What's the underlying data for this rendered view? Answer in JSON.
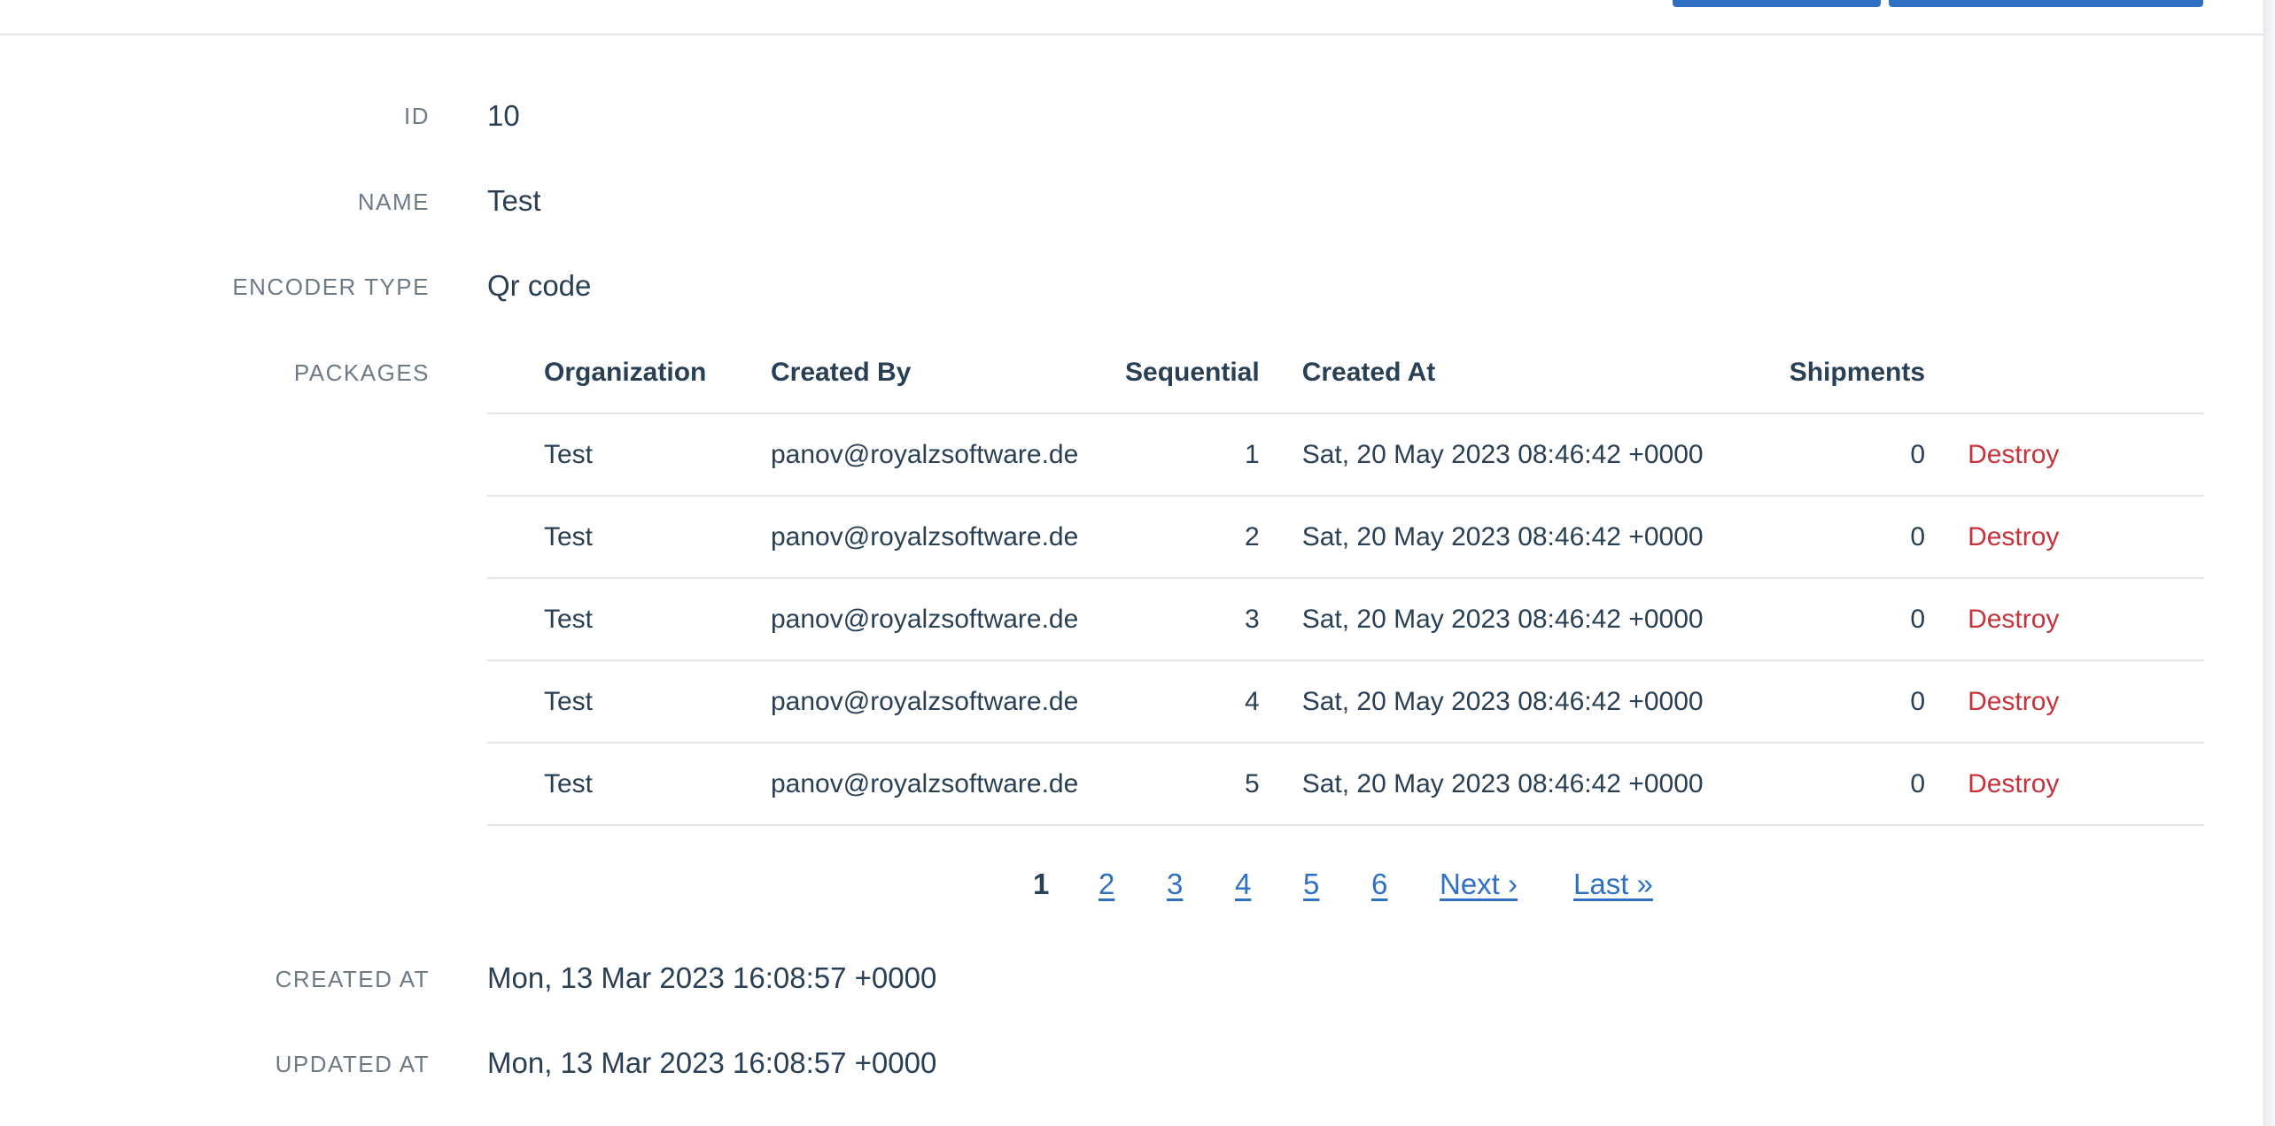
{
  "record": {
    "id_label": "ID",
    "id_value": "10",
    "name_label": "NAME",
    "name_value": "Test",
    "encoder_type_label": "ENCODER TYPE",
    "encoder_type_value": "Qr code",
    "packages_label": "PACKAGES",
    "created_at_label": "CREATED AT",
    "created_at_value": "Mon, 13 Mar 2023 16:08:57 +0000",
    "updated_at_label": "UPDATED AT",
    "updated_at_value": "Mon, 13 Mar 2023 16:08:57 +0000"
  },
  "packages": {
    "columns": [
      "Organization",
      "Created By",
      "Sequential",
      "Created At",
      "Shipments"
    ],
    "rows": [
      {
        "organization": "Test",
        "created_by": "panov@royalzsoftware.de",
        "sequential": "1",
        "created_at": "Sat, 20 May 2023 08:46:42 +0000",
        "shipments": "0",
        "action": "Destroy"
      },
      {
        "organization": "Test",
        "created_by": "panov@royalzsoftware.de",
        "sequential": "2",
        "created_at": "Sat, 20 May 2023 08:46:42 +0000",
        "shipments": "0",
        "action": "Destroy"
      },
      {
        "organization": "Test",
        "created_by": "panov@royalzsoftware.de",
        "sequential": "3",
        "created_at": "Sat, 20 May 2023 08:46:42 +0000",
        "shipments": "0",
        "action": "Destroy"
      },
      {
        "organization": "Test",
        "created_by": "panov@royalzsoftware.de",
        "sequential": "4",
        "created_at": "Sat, 20 May 2023 08:46:42 +0000",
        "shipments": "0",
        "action": "Destroy"
      },
      {
        "organization": "Test",
        "created_by": "panov@royalzsoftware.de",
        "sequential": "5",
        "created_at": "Sat, 20 May 2023 08:46:42 +0000",
        "shipments": "0",
        "action": "Destroy"
      }
    ]
  },
  "pagination": {
    "current": "1",
    "pages": [
      "2",
      "3",
      "4",
      "5",
      "6"
    ],
    "next_label": "Next ›",
    "last_label": "Last »"
  },
  "colors": {
    "link": "#2f70c2",
    "destroy": "#c8323a",
    "text": "#293f54",
    "label": "#6e7a86",
    "primary_button": "#2f70c2"
  }
}
